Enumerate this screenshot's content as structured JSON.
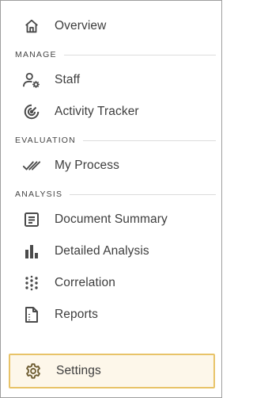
{
  "nav": {
    "overview": {
      "label": "Overview",
      "icon": "home-icon"
    },
    "sections": {
      "manage": {
        "title": "MANAGE",
        "items": [
          {
            "label": "Staff",
            "icon": "user-gear-icon"
          },
          {
            "label": "Activity Tracker",
            "icon": "radar-icon"
          }
        ]
      },
      "evaluation": {
        "title": "EVALUATION",
        "items": [
          {
            "label": "My Process",
            "icon": "double-check-icon"
          }
        ]
      },
      "analysis": {
        "title": "ANALYSIS",
        "items": [
          {
            "label": "Document Summary",
            "icon": "document-lines-icon"
          },
          {
            "label": "Detailed Analysis",
            "icon": "bar-chart-icon"
          },
          {
            "label": "Correlation",
            "icon": "dots-grid-icon"
          },
          {
            "label": "Reports",
            "icon": "report-icon"
          }
        ]
      }
    },
    "settings": {
      "label": "Settings",
      "icon": "gear-icon",
      "active": true
    }
  },
  "colors": {
    "active_background": "#fdf7ea",
    "active_border": "#e8c368",
    "active_icon": "#6b5a2e",
    "icon": "#4a4a4a",
    "divider": "#dcdcdc",
    "panel_border": "#9e9e9e"
  }
}
